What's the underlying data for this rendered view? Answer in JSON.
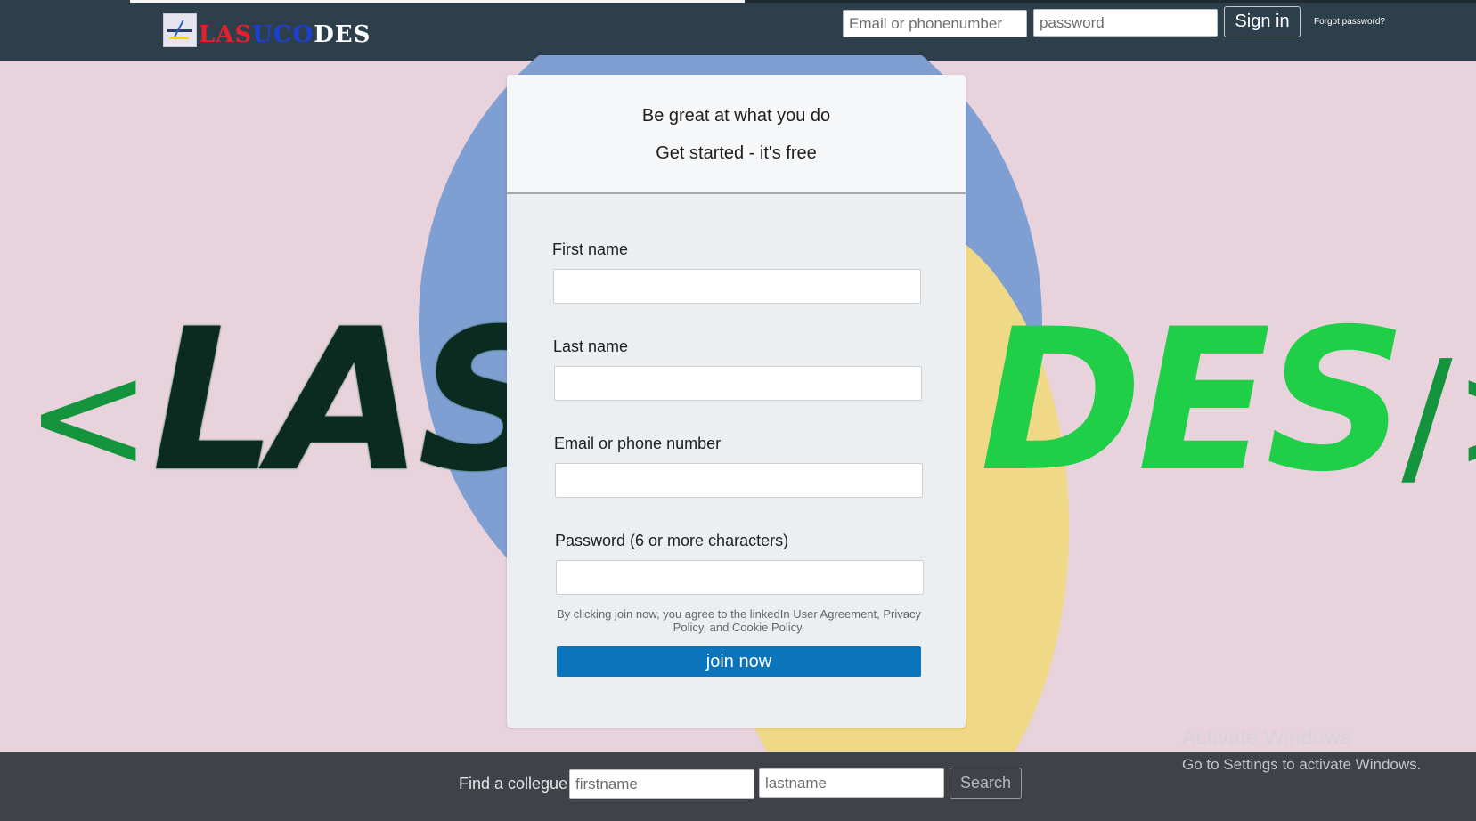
{
  "header": {
    "brand": {
      "part1": "LAS",
      "part2": "UCO",
      "part3": "DES"
    },
    "login": {
      "email_placeholder": "Email or phonenumber",
      "password_placeholder": "password",
      "signin_label": "Sign in",
      "forgot_label": "Forgot password?"
    }
  },
  "hero": {
    "logo_left": {
      "open": "<",
      "text": "LAS"
    },
    "logo_right": {
      "text": "DES",
      "slash": "/",
      "close": ">"
    }
  },
  "signup": {
    "headline": "Be great at what you do",
    "subheadline": "Get started - it's free",
    "fields": [
      {
        "label": "First name",
        "value": ""
      },
      {
        "label": "Last name",
        "value": ""
      },
      {
        "label": "Email or phone number",
        "value": ""
      },
      {
        "label": "Password (6 or more characters)",
        "value": ""
      }
    ],
    "terms": "By clicking join now, you agree to the linkedIn User Agreement, Privacy Policy, and Cookie Policy.",
    "join_label": "join now"
  },
  "footer": {
    "find_label": "Find a collegue",
    "firstname_placeholder": "firstname",
    "lastname_placeholder": "lastname",
    "search_label": "Search"
  },
  "watermark": {
    "title": "Activate Windows",
    "subtitle": "Go to Settings to activate Windows."
  },
  "colors": {
    "header_bg": "#2e3f4c",
    "page_bg": "#e8d2dc",
    "join_button": "#0b74bb",
    "footer_bg": "#3f4349"
  }
}
